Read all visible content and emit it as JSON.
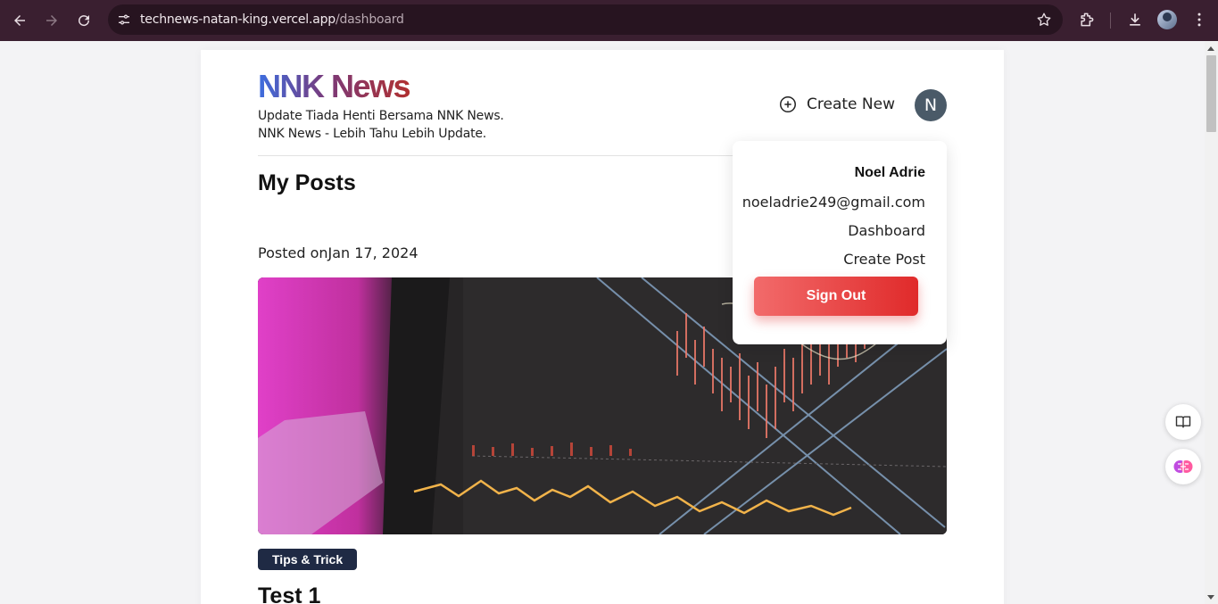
{
  "browser": {
    "url_host": "technews-natan-king.vercel.app",
    "url_path": "/dashboard"
  },
  "header": {
    "logo": "NNK News",
    "tagline_line1": "Update Tiada Henti Bersama NNK News.",
    "tagline_line2": "NNK News - Lebih Tahu Lebih Update.",
    "create_new_label": "Create New",
    "avatar_initial": "N"
  },
  "main": {
    "section_title": "My Posts",
    "post": {
      "posted_prefix": "Posted on",
      "posted_date": "Jan 17, 2024",
      "category": "Tips & Trick",
      "title": "Test 1"
    }
  },
  "dropdown": {
    "user_name": "Noel Adrie",
    "email": "noeladrie249@gmail.com",
    "dashboard_label": "Dashboard",
    "create_post_label": "Create Post",
    "sign_out_label": "Sign Out"
  },
  "colors": {
    "browser_bar": "#3a1f30",
    "avatar_bg": "#4a5a68",
    "tag_bg": "#1f2a44",
    "signout_start": "#f26b6b",
    "signout_end": "#e02a2a"
  }
}
